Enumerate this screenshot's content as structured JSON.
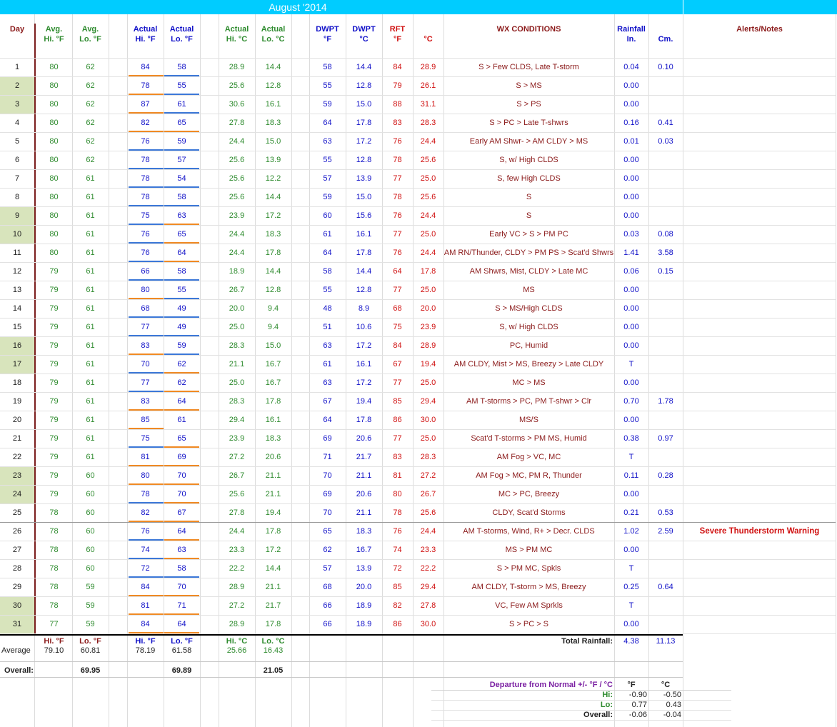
{
  "title": "August '2014",
  "headers": [
    {
      "key": "day",
      "l1": "Day",
      "l2": "",
      "cls": "maroon"
    },
    {
      "key": "avg_hi",
      "l1": "Avg.",
      "l2": "Hi. °F",
      "cls": "green"
    },
    {
      "key": "avg_lo",
      "l1": "Avg.",
      "l2": "Lo. °F",
      "cls": "green"
    },
    {
      "key": "act_hi_f",
      "l1": "Actual",
      "l2": "Hi. °F",
      "cls": "blue"
    },
    {
      "key": "act_lo_f",
      "l1": "Actual",
      "l2": "Lo. °F",
      "cls": "blue"
    },
    {
      "key": "act_hi_c",
      "l1": "Actual",
      "l2": "Hi. °C",
      "cls": "green"
    },
    {
      "key": "act_lo_c",
      "l1": "Actual",
      "l2": "Lo. °C",
      "cls": "green"
    },
    {
      "key": "dwpt_f",
      "l1": "DWPT",
      "l2": "°F",
      "cls": "blue"
    },
    {
      "key": "dwpt_c",
      "l1": "DWPT",
      "l2": "°C",
      "cls": "blue"
    },
    {
      "key": "rft_f",
      "l1": "RFT",
      "l2": "°F",
      "cls": "red"
    },
    {
      "key": "rft_c",
      "l1": "",
      "l2": "°C",
      "cls": "red"
    },
    {
      "key": "wx",
      "l1": "WX CONDITIONS",
      "l2": "",
      "cls": "maroon"
    },
    {
      "key": "rain_in",
      "l1": "Rainfall",
      "l2": "In.",
      "cls": "blue"
    },
    {
      "key": "rain_cm",
      "l1": "",
      "l2": "Cm.",
      "cls": "blue"
    },
    {
      "key": "alerts",
      "l1": "Alerts/Notes",
      "l2": "",
      "cls": "maroon"
    }
  ],
  "rows": [
    {
      "day": "1",
      "avg_hi": "80",
      "avg_lo": "62",
      "act_hi_f": "84",
      "act_lo_f": "58",
      "act_hi_c": "28.9",
      "act_lo_c": "14.4",
      "dwpt_f": "58",
      "dwpt_c": "14.4",
      "rft_f": "84",
      "rft_c": "28.9",
      "wx": "S > Few CLDS, Late T-storm",
      "rain_in": "0.04",
      "rain_cm": "0.10",
      "alert": "",
      "weekend": false,
      "hi_ul": "orange",
      "lo_ul": "blue"
    },
    {
      "day": "2",
      "avg_hi": "80",
      "avg_lo": "62",
      "act_hi_f": "78",
      "act_lo_f": "55",
      "act_hi_c": "25.6",
      "act_lo_c": "12.8",
      "dwpt_f": "55",
      "dwpt_c": "12.8",
      "rft_f": "79",
      "rft_c": "26.1",
      "wx": "S > MS",
      "rain_in": "0.00",
      "rain_cm": "",
      "alert": "",
      "weekend": true,
      "hi_ul": "orange",
      "lo_ul": "blue"
    },
    {
      "day": "3",
      "avg_hi": "80",
      "avg_lo": "62",
      "act_hi_f": "87",
      "act_lo_f": "61",
      "act_hi_c": "30.6",
      "act_lo_c": "16.1",
      "dwpt_f": "59",
      "dwpt_c": "15.0",
      "rft_f": "88",
      "rft_c": "31.1",
      "wx": "S > PS",
      "rain_in": "0.00",
      "rain_cm": "",
      "alert": "",
      "weekend": true,
      "hi_ul": "orange",
      "lo_ul": "blue"
    },
    {
      "day": "4",
      "avg_hi": "80",
      "avg_lo": "62",
      "act_hi_f": "82",
      "act_lo_f": "65",
      "act_hi_c": "27.8",
      "act_lo_c": "18.3",
      "dwpt_f": "64",
      "dwpt_c": "17.8",
      "rft_f": "83",
      "rft_c": "28.3",
      "wx": "S > PC > Late T-shwrs",
      "rain_in": "0.16",
      "rain_cm": "0.41",
      "alert": "",
      "weekend": false,
      "hi_ul": "orange",
      "lo_ul": "orange"
    },
    {
      "day": "5",
      "avg_hi": "80",
      "avg_lo": "62",
      "act_hi_f": "76",
      "act_lo_f": "59",
      "act_hi_c": "24.4",
      "act_lo_c": "15.0",
      "dwpt_f": "63",
      "dwpt_c": "17.2",
      "rft_f": "76",
      "rft_c": "24.4",
      "wx": "Early AM Shwr- > AM CLDY > MS",
      "rain_in": "0.01",
      "rain_cm": "0.03",
      "alert": "",
      "weekend": false,
      "hi_ul": "blue",
      "lo_ul": "blue"
    },
    {
      "day": "6",
      "avg_hi": "80",
      "avg_lo": "62",
      "act_hi_f": "78",
      "act_lo_f": "57",
      "act_hi_c": "25.6",
      "act_lo_c": "13.9",
      "dwpt_f": "55",
      "dwpt_c": "12.8",
      "rft_f": "78",
      "rft_c": "25.6",
      "wx": "S, w/ High CLDS",
      "rain_in": "0.00",
      "rain_cm": "",
      "alert": "",
      "weekend": false,
      "hi_ul": "blue",
      "lo_ul": "blue"
    },
    {
      "day": "7",
      "avg_hi": "80",
      "avg_lo": "61",
      "act_hi_f": "78",
      "act_lo_f": "54",
      "act_hi_c": "25.6",
      "act_lo_c": "12.2",
      "dwpt_f": "57",
      "dwpt_c": "13.9",
      "rft_f": "77",
      "rft_c": "25.0",
      "wx": "S, few High CLDS",
      "rain_in": "0.00",
      "rain_cm": "",
      "alert": "",
      "weekend": false,
      "hi_ul": "blue",
      "lo_ul": "blue"
    },
    {
      "day": "8",
      "avg_hi": "80",
      "avg_lo": "61",
      "act_hi_f": "78",
      "act_lo_f": "58",
      "act_hi_c": "25.6",
      "act_lo_c": "14.4",
      "dwpt_f": "59",
      "dwpt_c": "15.0",
      "rft_f": "78",
      "rft_c": "25.6",
      "wx": "S",
      "rain_in": "0.00",
      "rain_cm": "",
      "alert": "",
      "weekend": false,
      "hi_ul": "blue",
      "lo_ul": "blue"
    },
    {
      "day": "9",
      "avg_hi": "80",
      "avg_lo": "61",
      "act_hi_f": "75",
      "act_lo_f": "63",
      "act_hi_c": "23.9",
      "act_lo_c": "17.2",
      "dwpt_f": "60",
      "dwpt_c": "15.6",
      "rft_f": "76",
      "rft_c": "24.4",
      "wx": "S",
      "rain_in": "0.00",
      "rain_cm": "",
      "alert": "",
      "weekend": true,
      "hi_ul": "blue",
      "lo_ul": "orange"
    },
    {
      "day": "10",
      "avg_hi": "80",
      "avg_lo": "61",
      "act_hi_f": "76",
      "act_lo_f": "65",
      "act_hi_c": "24.4",
      "act_lo_c": "18.3",
      "dwpt_f": "61",
      "dwpt_c": "16.1",
      "rft_f": "77",
      "rft_c": "25.0",
      "wx": "Early VC > S > PM PC",
      "rain_in": "0.03",
      "rain_cm": "0.08",
      "alert": "",
      "weekend": true,
      "hi_ul": "blue",
      "lo_ul": "orange"
    },
    {
      "day": "11",
      "avg_hi": "80",
      "avg_lo": "61",
      "act_hi_f": "76",
      "act_lo_f": "64",
      "act_hi_c": "24.4",
      "act_lo_c": "17.8",
      "dwpt_f": "64",
      "dwpt_c": "17.8",
      "rft_f": "76",
      "rft_c": "24.4",
      "wx": "AM RN/Thunder, CLDY > PM PS > Scat'd Shwrs",
      "rain_in": "1.41",
      "rain_cm": "3.58",
      "alert": "",
      "weekend": false,
      "hi_ul": "blue",
      "lo_ul": "orange"
    },
    {
      "day": "12",
      "avg_hi": "79",
      "avg_lo": "61",
      "act_hi_f": "66",
      "act_lo_f": "58",
      "act_hi_c": "18.9",
      "act_lo_c": "14.4",
      "dwpt_f": "58",
      "dwpt_c": "14.4",
      "rft_f": "64",
      "rft_c": "17.8",
      "wx": "AM Shwrs, Mist, CLDY > Late MC",
      "rain_in": "0.06",
      "rain_cm": "0.15",
      "alert": "",
      "weekend": false,
      "hi_ul": "blue",
      "lo_ul": "blue"
    },
    {
      "day": "13",
      "avg_hi": "79",
      "avg_lo": "61",
      "act_hi_f": "80",
      "act_lo_f": "55",
      "act_hi_c": "26.7",
      "act_lo_c": "12.8",
      "dwpt_f": "55",
      "dwpt_c": "12.8",
      "rft_f": "77",
      "rft_c": "25.0",
      "wx": "MS",
      "rain_in": "0.00",
      "rain_cm": "",
      "alert": "",
      "weekend": false,
      "hi_ul": "orange",
      "lo_ul": "blue"
    },
    {
      "day": "14",
      "avg_hi": "79",
      "avg_lo": "61",
      "act_hi_f": "68",
      "act_lo_f": "49",
      "act_hi_c": "20.0",
      "act_lo_c": "9.4",
      "dwpt_f": "48",
      "dwpt_c": "8.9",
      "rft_f": "68",
      "rft_c": "20.0",
      "wx": "S > MS/High CLDS",
      "rain_in": "0.00",
      "rain_cm": "",
      "alert": "",
      "weekend": false,
      "hi_ul": "blue",
      "lo_ul": "blue"
    },
    {
      "day": "15",
      "avg_hi": "79",
      "avg_lo": "61",
      "act_hi_f": "77",
      "act_lo_f": "49",
      "act_hi_c": "25.0",
      "act_lo_c": "9.4",
      "dwpt_f": "51",
      "dwpt_c": "10.6",
      "rft_f": "75",
      "rft_c": "23.9",
      "wx": "S, w/ High CLDS",
      "rain_in": "0.00",
      "rain_cm": "",
      "alert": "",
      "weekend": false,
      "hi_ul": "blue",
      "lo_ul": "blue"
    },
    {
      "day": "16",
      "avg_hi": "79",
      "avg_lo": "61",
      "act_hi_f": "83",
      "act_lo_f": "59",
      "act_hi_c": "28.3",
      "act_lo_c": "15.0",
      "dwpt_f": "63",
      "dwpt_c": "17.2",
      "rft_f": "84",
      "rft_c": "28.9",
      "wx": "PC, Humid",
      "rain_in": "0.00",
      "rain_cm": "",
      "alert": "",
      "weekend": true,
      "hi_ul": "orange",
      "lo_ul": "blue"
    },
    {
      "day": "17",
      "avg_hi": "79",
      "avg_lo": "61",
      "act_hi_f": "70",
      "act_lo_f": "62",
      "act_hi_c": "21.1",
      "act_lo_c": "16.7",
      "dwpt_f": "61",
      "dwpt_c": "16.1",
      "rft_f": "67",
      "rft_c": "19.4",
      "wx": "AM CLDY, Mist > MS, Breezy > Late CLDY",
      "rain_in": "T",
      "rain_cm": "",
      "alert": "",
      "weekend": true,
      "hi_ul": "blue",
      "lo_ul": "orange"
    },
    {
      "day": "18",
      "avg_hi": "79",
      "avg_lo": "61",
      "act_hi_f": "77",
      "act_lo_f": "62",
      "act_hi_c": "25.0",
      "act_lo_c": "16.7",
      "dwpt_f": "63",
      "dwpt_c": "17.2",
      "rft_f": "77",
      "rft_c": "25.0",
      "wx": "MC > MS",
      "rain_in": "0.00",
      "rain_cm": "",
      "alert": "",
      "weekend": false,
      "hi_ul": "blue",
      "lo_ul": "orange"
    },
    {
      "day": "19",
      "avg_hi": "79",
      "avg_lo": "61",
      "act_hi_f": "83",
      "act_lo_f": "64",
      "act_hi_c": "28.3",
      "act_lo_c": "17.8",
      "dwpt_f": "67",
      "dwpt_c": "19.4",
      "rft_f": "85",
      "rft_c": "29.4",
      "wx": "AM T-storms > PC, PM T-shwr > Clr",
      "rain_in": "0.70",
      "rain_cm": "1.78",
      "alert": "",
      "weekend": false,
      "hi_ul": "orange",
      "lo_ul": "orange"
    },
    {
      "day": "20",
      "avg_hi": "79",
      "avg_lo": "61",
      "act_hi_f": "85",
      "act_lo_f": "61",
      "act_hi_c": "29.4",
      "act_lo_c": "16.1",
      "dwpt_f": "64",
      "dwpt_c": "17.8",
      "rft_f": "86",
      "rft_c": "30.0",
      "wx": "MS/S",
      "rain_in": "0.00",
      "rain_cm": "",
      "alert": "",
      "weekend": false,
      "hi_ul": "orange",
      "lo_ul": "none"
    },
    {
      "day": "21",
      "avg_hi": "79",
      "avg_lo": "61",
      "act_hi_f": "75",
      "act_lo_f": "65",
      "act_hi_c": "23.9",
      "act_lo_c": "18.3",
      "dwpt_f": "69",
      "dwpt_c": "20.6",
      "rft_f": "77",
      "rft_c": "25.0",
      "wx": "Scat'd T-storms > PM MS, Humid",
      "rain_in": "0.38",
      "rain_cm": "0.97",
      "alert": "",
      "weekend": false,
      "hi_ul": "blue",
      "lo_ul": "orange"
    },
    {
      "day": "22",
      "avg_hi": "79",
      "avg_lo": "61",
      "act_hi_f": "81",
      "act_lo_f": "69",
      "act_hi_c": "27.2",
      "act_lo_c": "20.6",
      "dwpt_f": "71",
      "dwpt_c": "21.7",
      "rft_f": "83",
      "rft_c": "28.3",
      "wx": "AM Fog > VC, MC",
      "rain_in": "T",
      "rain_cm": "",
      "alert": "",
      "weekend": false,
      "hi_ul": "orange",
      "lo_ul": "orange"
    },
    {
      "day": "23",
      "avg_hi": "79",
      "avg_lo": "60",
      "act_hi_f": "80",
      "act_lo_f": "70",
      "act_hi_c": "26.7",
      "act_lo_c": "21.1",
      "dwpt_f": "70",
      "dwpt_c": "21.1",
      "rft_f": "81",
      "rft_c": "27.2",
      "wx": "AM Fog > MC, PM R, Thunder",
      "rain_in": "0.11",
      "rain_cm": "0.28",
      "alert": "",
      "weekend": true,
      "hi_ul": "orange",
      "lo_ul": "orange"
    },
    {
      "day": "24",
      "avg_hi": "79",
      "avg_lo": "60",
      "act_hi_f": "78",
      "act_lo_f": "70",
      "act_hi_c": "25.6",
      "act_lo_c": "21.1",
      "dwpt_f": "69",
      "dwpt_c": "20.6",
      "rft_f": "80",
      "rft_c": "26.7",
      "wx": "MC > PC, Breezy",
      "rain_in": "0.00",
      "rain_cm": "",
      "alert": "",
      "weekend": true,
      "hi_ul": "blue",
      "lo_ul": "orange"
    },
    {
      "day": "25",
      "avg_hi": "78",
      "avg_lo": "60",
      "act_hi_f": "82",
      "act_lo_f": "67",
      "act_hi_c": "27.8",
      "act_lo_c": "19.4",
      "dwpt_f": "70",
      "dwpt_c": "21.1",
      "rft_f": "78",
      "rft_c": "25.6",
      "wx": "CLDY, Scat'd Storms",
      "rain_in": "0.21",
      "rain_cm": "0.53",
      "alert": "",
      "weekend": false,
      "hi_ul": "orange",
      "lo_ul": "orange"
    },
    {
      "day": "26",
      "avg_hi": "78",
      "avg_lo": "60",
      "act_hi_f": "76",
      "act_lo_f": "64",
      "act_hi_c": "24.4",
      "act_lo_c": "17.8",
      "dwpt_f": "65",
      "dwpt_c": "18.3",
      "rft_f": "76",
      "rft_c": "24.4",
      "wx": "AM T-storms, Wind, R+ > Decr. CLDS",
      "rain_in": "1.02",
      "rain_cm": "2.59",
      "alert": "Severe Thunderstorm Warning",
      "weekend": false,
      "hi_ul": "blue",
      "lo_ul": "orange"
    },
    {
      "day": "27",
      "avg_hi": "78",
      "avg_lo": "60",
      "act_hi_f": "74",
      "act_lo_f": "63",
      "act_hi_c": "23.3",
      "act_lo_c": "17.2",
      "dwpt_f": "62",
      "dwpt_c": "16.7",
      "rft_f": "74",
      "rft_c": "23.3",
      "wx": "MS > PM MC",
      "rain_in": "0.00",
      "rain_cm": "",
      "alert": "",
      "weekend": false,
      "hi_ul": "blue",
      "lo_ul": "orange"
    },
    {
      "day": "28",
      "avg_hi": "78",
      "avg_lo": "60",
      "act_hi_f": "72",
      "act_lo_f": "58",
      "act_hi_c": "22.2",
      "act_lo_c": "14.4",
      "dwpt_f": "57",
      "dwpt_c": "13.9",
      "rft_f": "72",
      "rft_c": "22.2",
      "wx": "S > PM MC, Spkls",
      "rain_in": "T",
      "rain_cm": "",
      "alert": "",
      "weekend": false,
      "hi_ul": "blue",
      "lo_ul": "blue"
    },
    {
      "day": "29",
      "avg_hi": "78",
      "avg_lo": "59",
      "act_hi_f": "84",
      "act_lo_f": "70",
      "act_hi_c": "28.9",
      "act_lo_c": "21.1",
      "dwpt_f": "68",
      "dwpt_c": "20.0",
      "rft_f": "85",
      "rft_c": "29.4",
      "wx": "AM CLDY, T-storm > MS, Breezy",
      "rain_in": "0.25",
      "rain_cm": "0.64",
      "alert": "",
      "weekend": false,
      "hi_ul": "orange",
      "lo_ul": "orange"
    },
    {
      "day": "30",
      "avg_hi": "78",
      "avg_lo": "59",
      "act_hi_f": "81",
      "act_lo_f": "71",
      "act_hi_c": "27.2",
      "act_lo_c": "21.7",
      "dwpt_f": "66",
      "dwpt_c": "18.9",
      "rft_f": "82",
      "rft_c": "27.8",
      "wx": "VC, Few AM Sprkls",
      "rain_in": "T",
      "rain_cm": "",
      "alert": "",
      "weekend": true,
      "hi_ul": "orange",
      "lo_ul": "orange"
    },
    {
      "day": "31",
      "avg_hi": "77",
      "avg_lo": "59",
      "act_hi_f": "84",
      "act_lo_f": "64",
      "act_hi_c": "28.9",
      "act_lo_c": "17.8",
      "dwpt_f": "66",
      "dwpt_c": "18.9",
      "rft_f": "86",
      "rft_c": "30.0",
      "wx": "S > PC > S",
      "rain_in": "0.00",
      "rain_cm": "",
      "alert": "",
      "weekend": true,
      "hi_ul": "orange",
      "lo_ul": "orange"
    }
  ],
  "summary": {
    "avg_label": "Average",
    "hdr_hi_f": "Hi. °F",
    "hdr_lo_f": "Lo. °F",
    "hdr_hi_c": "Hi. °C",
    "hdr_lo_c": "Lo. °C",
    "avg_hi": "79.10",
    "avg_lo": "60.81",
    "act_hi_f": "78.19",
    "act_lo_f": "61.58",
    "act_hi_c": "25.66",
    "act_lo_c": "16.43",
    "total_rain_label": "Total Rainfall:",
    "total_rain_in": "4.38",
    "total_rain_cm": "11.13",
    "overall_label": "Overall:",
    "overall_avg": "69.95",
    "overall_act_f": "69.89",
    "overall_act_c": "21.05"
  },
  "departure": {
    "title": "Departure from Normal +/- °F / °C",
    "col_f": "°F",
    "col_c": "°C",
    "rows": [
      {
        "label": "Hi:",
        "f": "-0.90",
        "c": "-0.50"
      },
      {
        "label": "Lo:",
        "f": "0.77",
        "c": "0.43"
      },
      {
        "label": "Overall:",
        "f": "-0.06",
        "c": "-0.04"
      }
    ]
  },
  "colors": {
    "title_bar": "#00ccff",
    "weekend": "#d8e4bc",
    "hi_underline": "#f08a24",
    "lo_underline": "#3c78d8"
  }
}
